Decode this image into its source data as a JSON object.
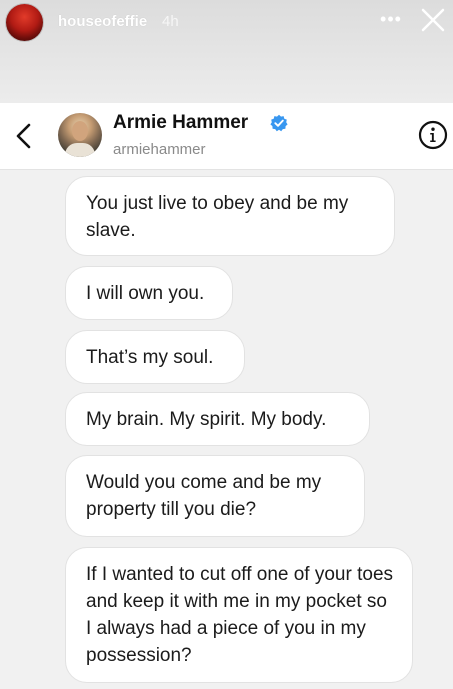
{
  "story": {
    "username": "houseofeffie",
    "time": "4h",
    "more_icon": "more-horizontal-icon",
    "close_icon": "close-icon"
  },
  "dm_header": {
    "name": "Armie Hammer",
    "handle": "armiehammer",
    "verified": true,
    "back_icon": "chevron-left-icon",
    "info_icon": "info-icon",
    "accent": "#3897f0"
  },
  "messages": [
    {
      "text": "You just live to obey and be my slave."
    },
    {
      "text": "I will own you."
    },
    {
      "text": "That’s my soul."
    },
    {
      "text": "My brain. My spirit. My body."
    },
    {
      "text": "Would you come and be my property till you die?"
    },
    {
      "text": "If I wanted to cut off one of your toes and keep it with me in my pocket so I always had a piece of you in my possession?"
    }
  ]
}
